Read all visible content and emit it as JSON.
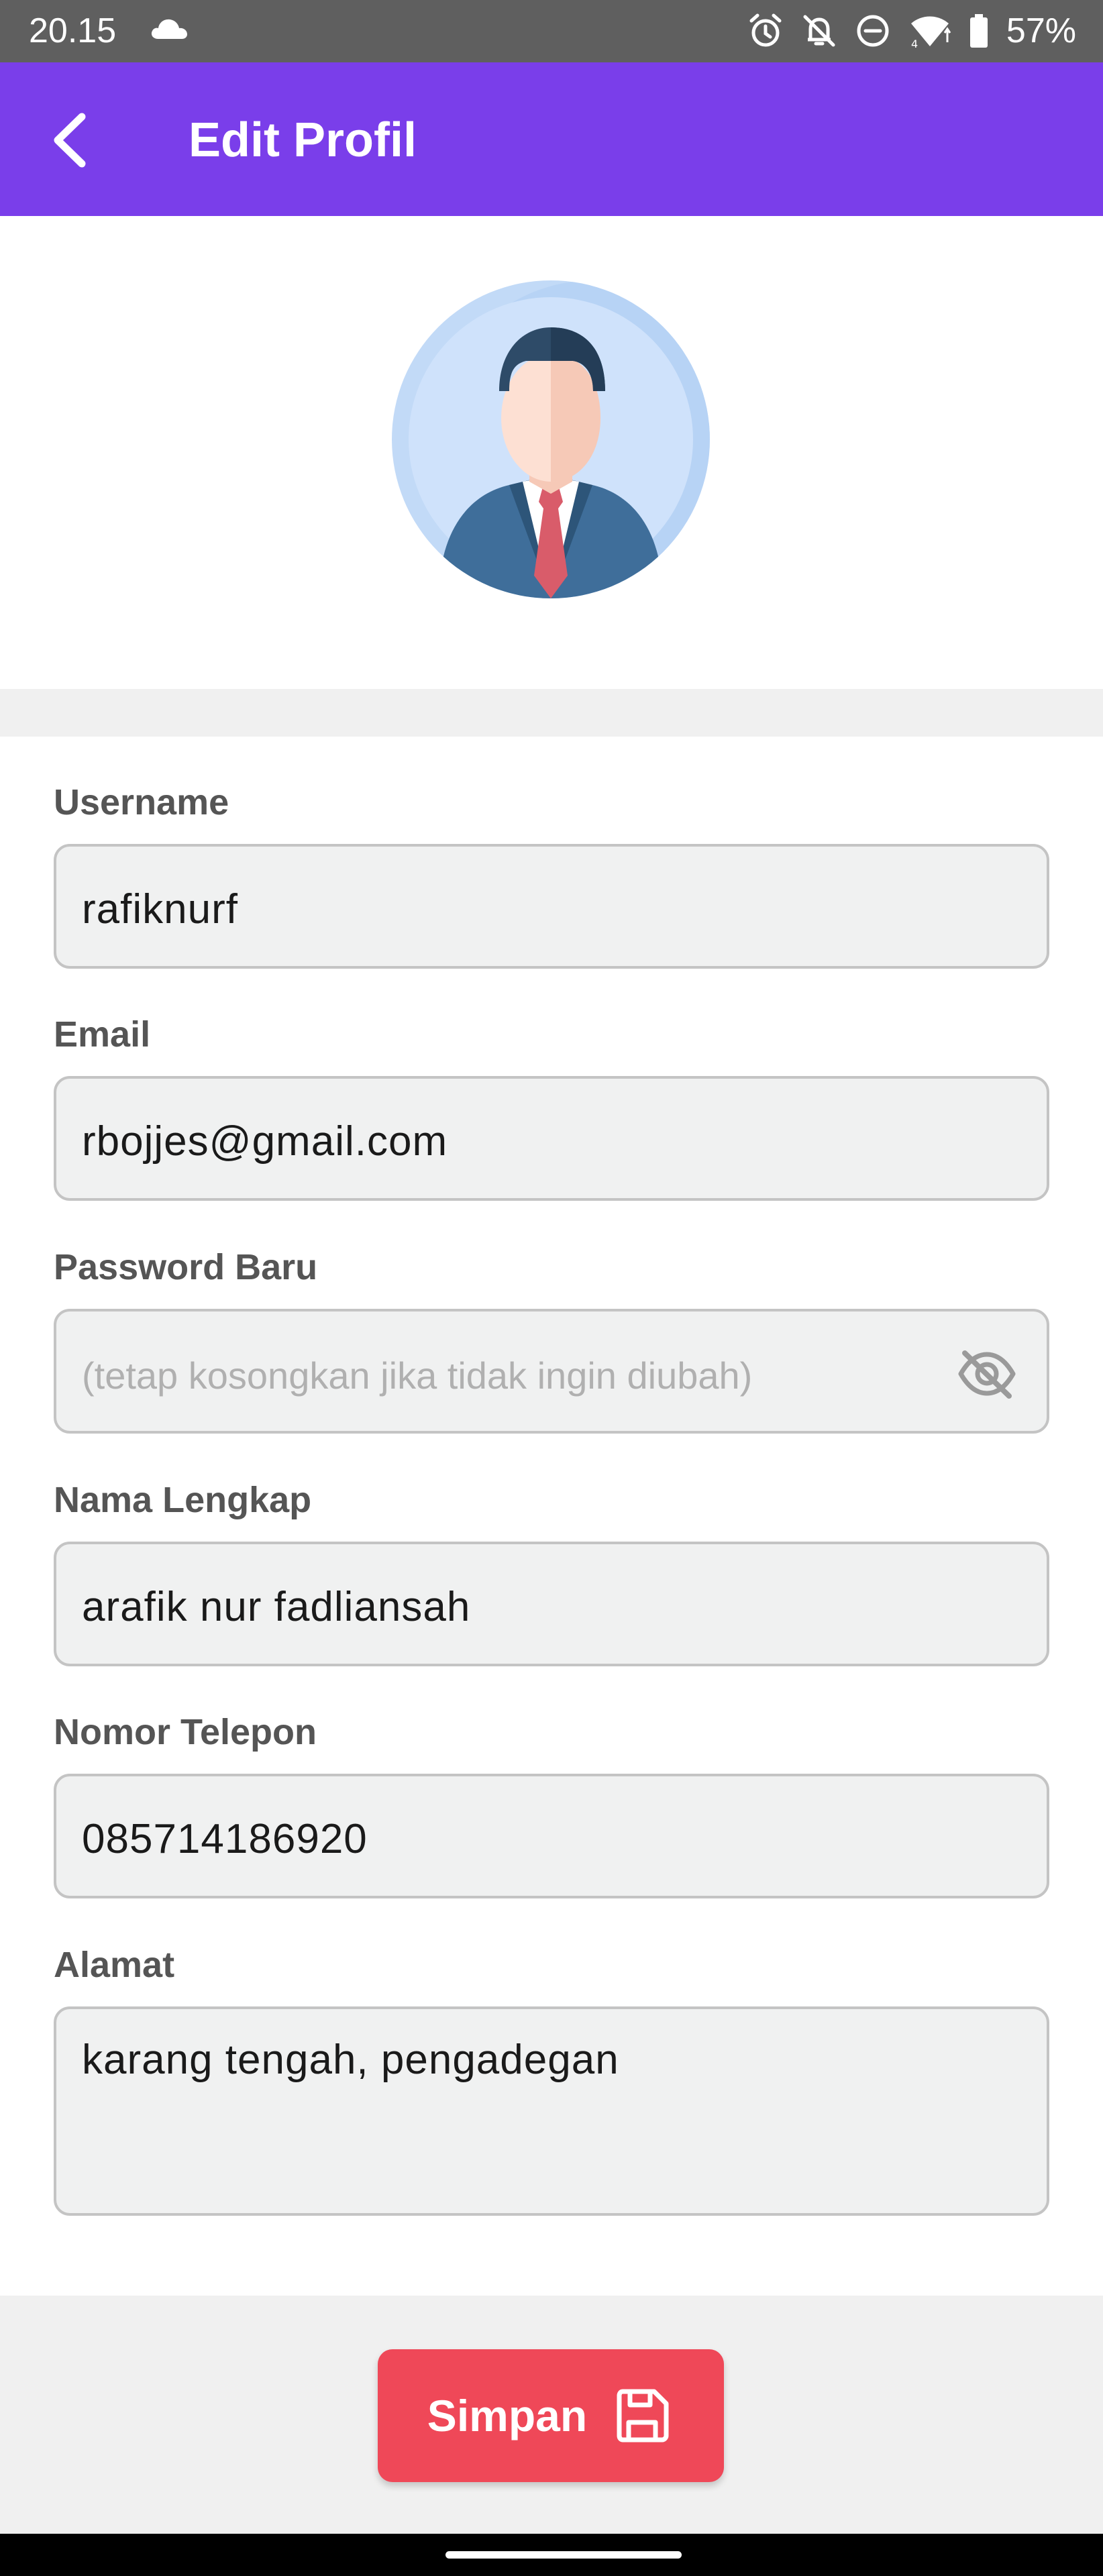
{
  "status_bar": {
    "time": "20.15",
    "battery": "57%",
    "icons": [
      "cloud-icon",
      "alarm-icon",
      "notifications-off-icon",
      "do-not-disturb-icon",
      "wifi-icon",
      "battery-icon"
    ]
  },
  "app_bar": {
    "back_icon": "chevron-left-icon",
    "title": "Edit Profil",
    "background": "#7a3eea"
  },
  "avatar": {
    "icon": "businessman-avatar-icon"
  },
  "form": {
    "username": {
      "label": "Username",
      "value": "rafiknurf"
    },
    "email": {
      "label": "Email",
      "value": "rbojjes@gmail.com"
    },
    "password": {
      "label": "Password Baru",
      "value": "",
      "placeholder": "(tetap kosongkan jika tidak ingin diubah)",
      "toggle_icon": "eye-off-icon"
    },
    "full_name": {
      "label": "Nama Lengkap",
      "value": "arafik nur fadliansah"
    },
    "phone": {
      "label": "Nomor Telepon",
      "value": "085714186920"
    },
    "address": {
      "label": "Alamat",
      "value": "karang tengah, pengadegan"
    }
  },
  "actions": {
    "save_label": "Simpan",
    "save_icon": "save-icon",
    "save_color": "#ef4858"
  }
}
